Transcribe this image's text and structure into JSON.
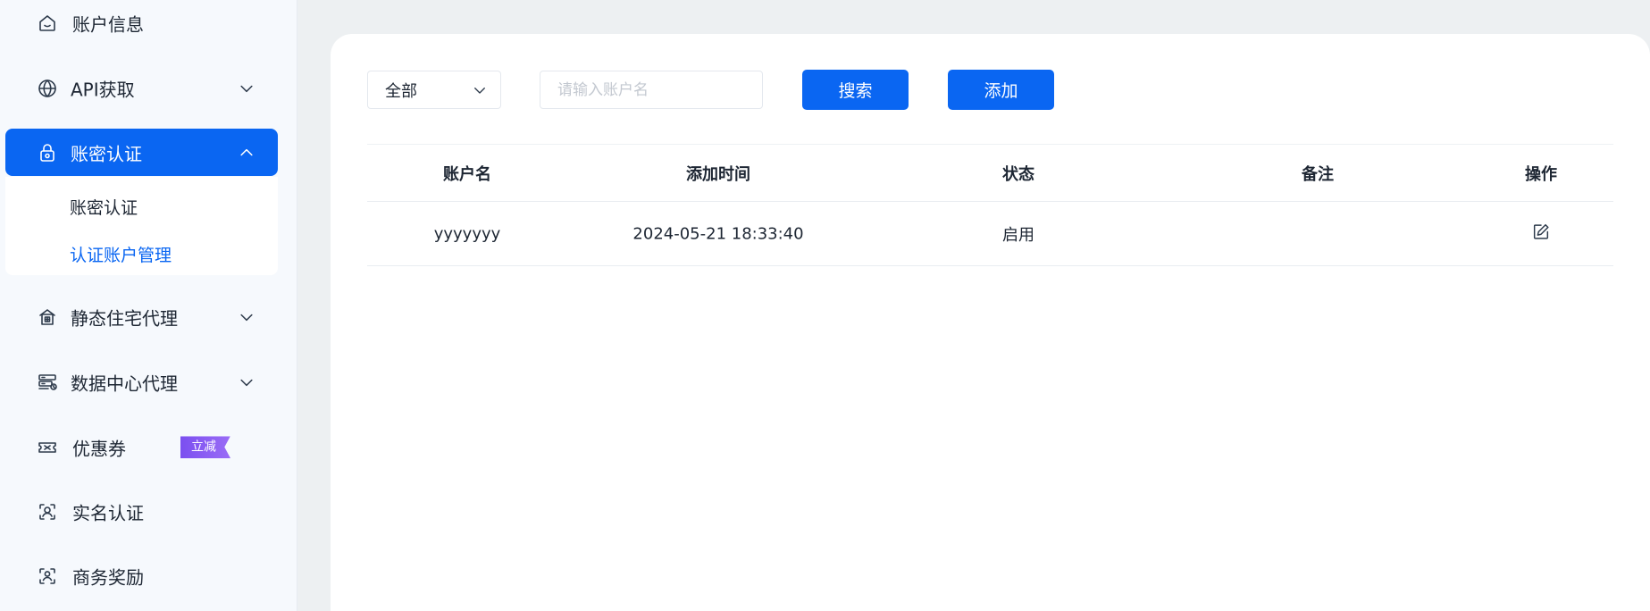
{
  "sidebar": {
    "items": [
      {
        "label": "账户信息",
        "icon": "home-icon"
      },
      {
        "label": "API获取",
        "icon": "globe-icon"
      },
      {
        "label": "账密认证",
        "icon": "lock-icon"
      },
      {
        "label": "静态住宅代理",
        "icon": "building-icon"
      },
      {
        "label": "数据中心代理",
        "icon": "server-icon"
      },
      {
        "label": "优惠券",
        "icon": "ticket-icon",
        "badge": "立减"
      },
      {
        "label": "实名认证",
        "icon": "face-scan-icon"
      },
      {
        "label": "商务奖励",
        "icon": "user-scan-icon"
      }
    ],
    "submenu": [
      {
        "label": "账密认证"
      },
      {
        "label": "认证账户管理"
      }
    ]
  },
  "toolbar": {
    "filter_value": "全部",
    "search_placeholder": "请输入账户名",
    "search_label": "搜索",
    "add_label": "添加"
  },
  "table": {
    "headers": [
      "账户名",
      "添加时间",
      "状态",
      "备注",
      "操作"
    ],
    "rows": [
      {
        "account": "yyyyyyy",
        "added_time": "2024-05-21 18:33:40",
        "status": "启用",
        "note": "",
        "action_icon": "edit-icon"
      }
    ]
  },
  "colors": {
    "accent": "#0a66f2",
    "badge": "#7b4ff0",
    "background": "#edf0f2"
  }
}
